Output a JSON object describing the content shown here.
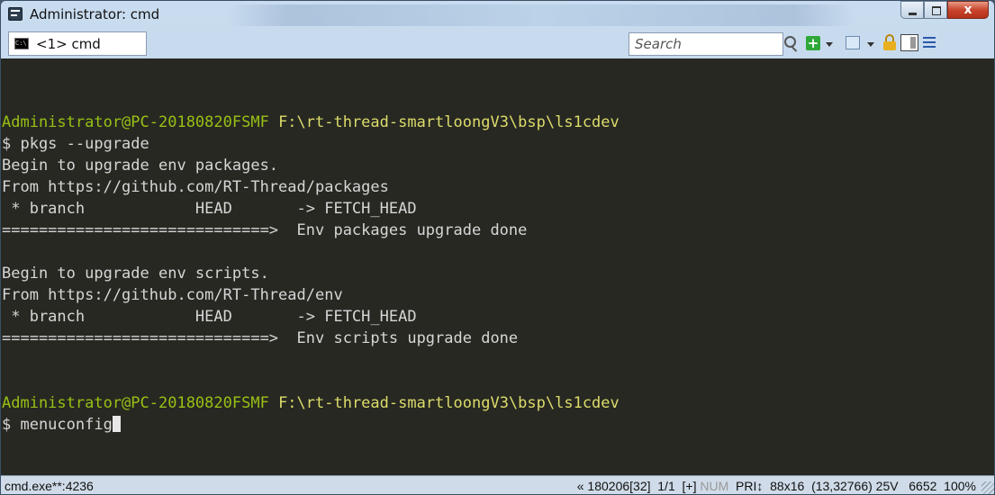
{
  "window": {
    "title": "Administrator: cmd",
    "close_glyph": "x",
    "controls": [
      "minimize",
      "maximize",
      "close"
    ]
  },
  "tabs": [
    {
      "label": "<1> cmd",
      "icon": "cmd-icon",
      "icon_text": "C:\\"
    }
  ],
  "search": {
    "placeholder": "Search"
  },
  "toolbar": {
    "plus_glyph": "+",
    "icons": [
      "search-icon",
      "new-console-plus-icon",
      "dropdown-icon",
      "window-icon",
      "dropdown-icon",
      "lock-icon",
      "panel-icon",
      "menu-icon"
    ]
  },
  "terminal": {
    "colors": {
      "background": "#272822",
      "prompt_user": "#98c015",
      "prompt_path": "#dcdc6a",
      "text": "#d6d6d6"
    },
    "prompt1_user": "Administrator@PC-20180820FSMF",
    "prompt1_path": "F:\\rt-thread-smartloongV3\\bsp\\ls1cdev",
    "cmd1": "$ pkgs --upgrade",
    "out1": "Begin to upgrade env packages.",
    "out2": "From https://github.com/RT-Thread/packages",
    "out3": " * branch            HEAD       -> FETCH_HEAD",
    "out4": "=============================>  Env packages upgrade done",
    "out5": "",
    "out6": "Begin to upgrade env scripts.",
    "out7": "From https://github.com/RT-Thread/env",
    "out8": " * branch            HEAD       -> FETCH_HEAD",
    "out9": "=============================>  Env scripts upgrade done",
    "prompt2_user": "Administrator@PC-20180820FSMF",
    "prompt2_path": "F:\\rt-thread-smartloongV3\\bsp\\ls1cdev",
    "cmd2": "$ menuconfig"
  },
  "statusbar": {
    "process": "cmd.exe**:4236",
    "info_a": "« 180206[32]  1/1  [+] ",
    "num": "NUM",
    "info_b": "  PRI↕  88x16  (13,32766) 25V   6652  100%"
  }
}
